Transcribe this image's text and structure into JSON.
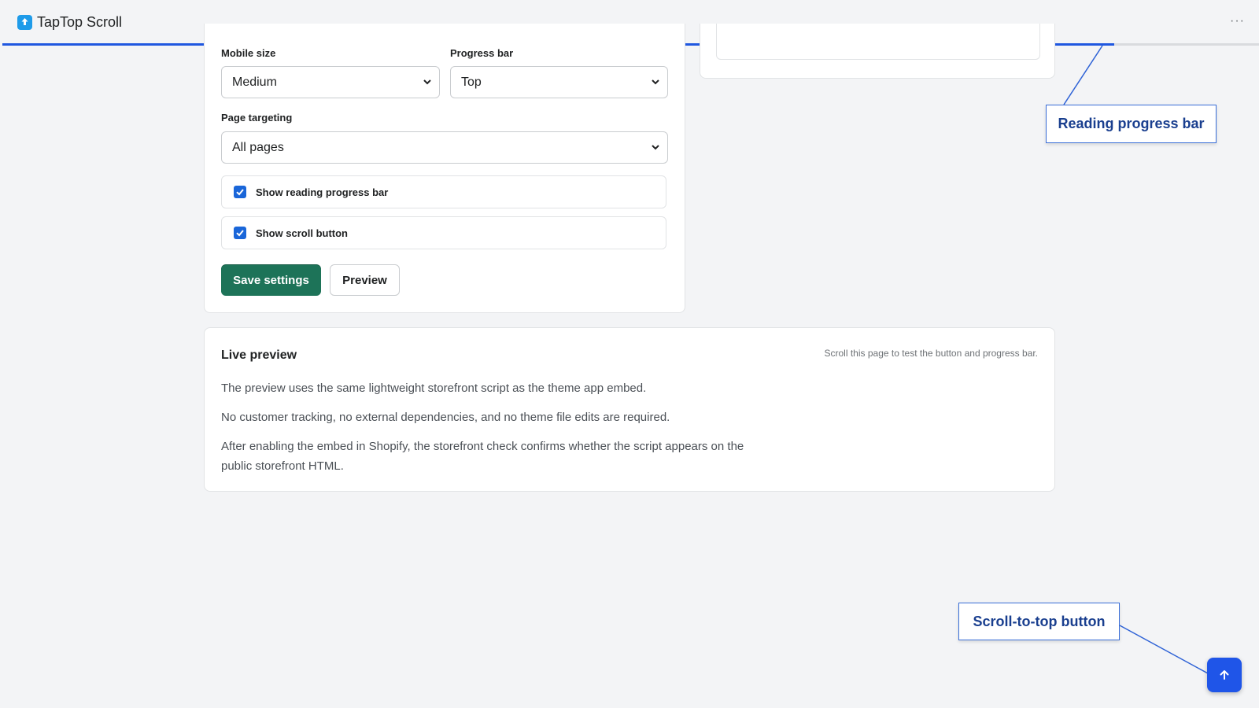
{
  "app": {
    "title": "TapTop Scroll",
    "icon": "upload-arrow-icon",
    "menu_icon": "more-horizontal-icon"
  },
  "reading_progress": {
    "fraction": 0.885,
    "color": "#1f57e0"
  },
  "settings": {
    "mobile_size": {
      "label": "Mobile size",
      "value": "Medium"
    },
    "progress_bar": {
      "label": "Progress bar",
      "value": "Top"
    },
    "page_targeting": {
      "label": "Page targeting",
      "value": "All pages"
    },
    "show_reading_progress_bar": {
      "label": "Show reading progress bar",
      "checked": true
    },
    "show_scroll_button": {
      "label": "Show scroll button",
      "checked": true
    },
    "save_label": "Save settings",
    "preview_label": "Preview"
  },
  "live_preview": {
    "title": "Live preview",
    "hint": "Scroll this page to test the button and progress bar.",
    "paragraphs": [
      "The preview uses the same lightweight storefront script as the theme app embed.",
      "No customer tracking, no external dependencies, and no theme file edits are required.",
      "After enabling the embed in Shopify, the storefront check confirms whether the script appears on the public storefront HTML."
    ]
  },
  "callouts": {
    "progress": "Reading progress bar",
    "scroll": "Scroll-to-top button"
  },
  "colors": {
    "accent": "#1f55e8",
    "primary_button": "#1d7358",
    "callout_border": "#3a6ed8"
  }
}
